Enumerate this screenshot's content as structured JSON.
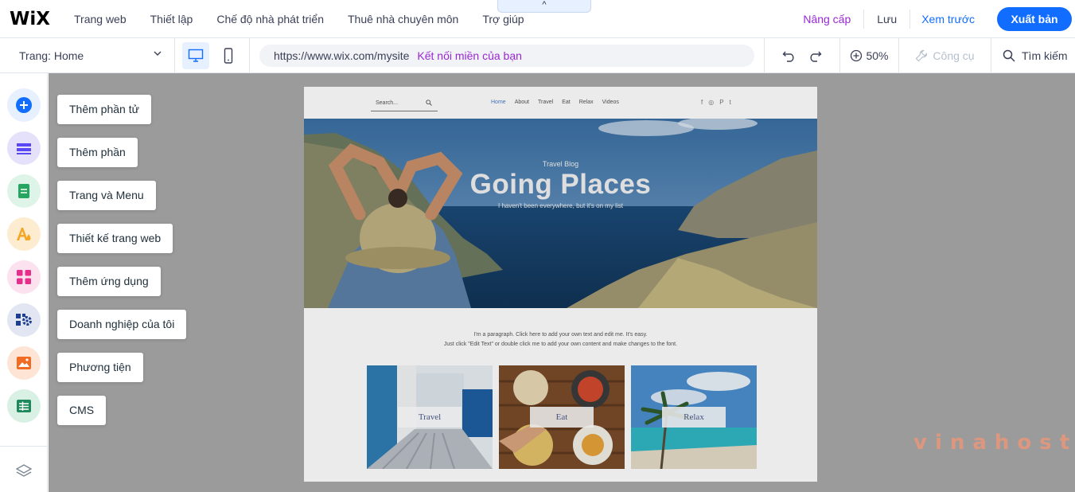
{
  "topbar": {
    "logo": "WiX",
    "nav": [
      "Trang web",
      "Thiết lập",
      "Chế độ nhà phát triển",
      "Thuê nhà chuyên môn",
      "Trợ giúp"
    ],
    "collapse_glyph": "^",
    "upgrade": "Nâng cấp",
    "save": "Lưu",
    "preview": "Xem trước",
    "publish": "Xuất bản"
  },
  "secondbar": {
    "page_label": "Trang: Home",
    "url": "https://www.wix.com/mysite",
    "connect_domain": "Kết nối miền của bạn",
    "zoom": "50%",
    "tools": "Công cụ",
    "search": "Tìm kiếm"
  },
  "leftrail": {
    "buttons": [
      {
        "icon": "plus-icon",
        "color": "#116dff",
        "bg": "#e7f0ff"
      },
      {
        "icon": "section-icon",
        "color": "#5a48f5",
        "bg": "#e5e1fb"
      },
      {
        "icon": "page-icon",
        "color": "#25a55f",
        "bg": "#dff4e8"
      },
      {
        "icon": "design-icon",
        "color": "#f5a623",
        "bg": "#fdeccf"
      },
      {
        "icon": "apps-icon",
        "color": "#e62e8a",
        "bg": "#fbe2ee"
      },
      {
        "icon": "business-icon",
        "color": "#1d3d8f",
        "bg": "#e1e6f2"
      },
      {
        "icon": "media-icon",
        "color": "#f26b22",
        "bg": "#fde4d5"
      },
      {
        "icon": "cms-icon",
        "color": "#1e8a5b",
        "bg": "#d9f0e4"
      }
    ]
  },
  "panel": {
    "items": [
      "Thêm phần tử",
      "Thêm phần",
      "Trang và Menu",
      "Thiết kế trang web",
      "Thêm ứng dụng",
      "Doanh nghiệp của tôi",
      "Phương tiện",
      "CMS"
    ]
  },
  "site": {
    "search_placeholder": "Search...",
    "nav": [
      "Home",
      "About",
      "Travel",
      "Eat",
      "Relax",
      "Videos"
    ],
    "social": [
      "f",
      "◎",
      "P",
      "t"
    ],
    "hero_eyebrow": "Travel Blog",
    "hero_title": "Going Places",
    "hero_subtitle": "I haven't been everywhere, but it's on my list",
    "paragraph_1": "I'm a paragraph. Click here to add your own text and edit me. It's easy.",
    "paragraph_2": "Just click \"Edit Text\" or double click me to add your own content and make changes to the font.",
    "cards": [
      "Travel",
      "Eat",
      "Relax"
    ]
  },
  "watermark": "vinahost"
}
